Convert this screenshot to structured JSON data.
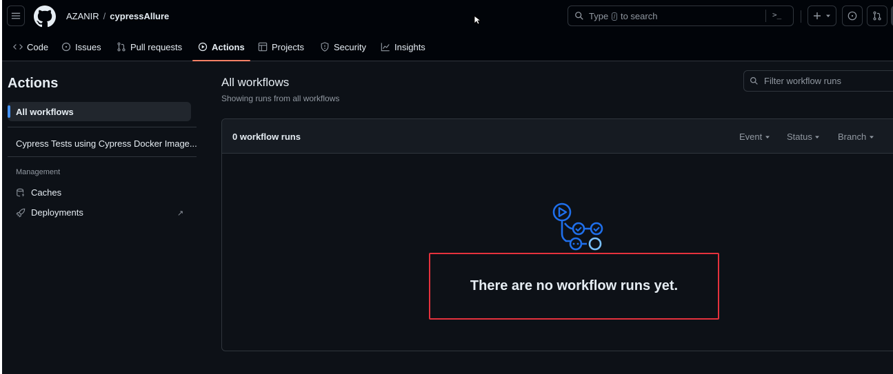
{
  "header": {
    "owner": "AZANIR",
    "separator": "/",
    "repo": "cypressAllure",
    "search_prefix": "Type",
    "search_key": "/",
    "search_suffix": "to search",
    "command_glyph": ">_"
  },
  "nav": {
    "tabs": [
      {
        "label": "Code",
        "icon": "code-icon"
      },
      {
        "label": "Issues",
        "icon": "issue-opened-icon"
      },
      {
        "label": "Pull requests",
        "icon": "git-pull-request-icon"
      },
      {
        "label": "Actions",
        "icon": "play-icon",
        "active": true
      },
      {
        "label": "Projects",
        "icon": "table-icon"
      },
      {
        "label": "Security",
        "icon": "shield-icon"
      },
      {
        "label": "Insights",
        "icon": "graph-icon"
      }
    ]
  },
  "sidebar": {
    "title": "Actions",
    "all_workflows": "All workflows",
    "workflow": "Cypress Tests using Cypress Docker Image...",
    "management_heading": "Management",
    "caches": "Caches",
    "deployments": "Deployments",
    "external_glyph": "↗"
  },
  "main": {
    "title": "All workflows",
    "subtitle": "Showing runs from all workflows",
    "filter_placeholder": "Filter workflow runs",
    "runs_count": "0 workflow runs",
    "filters": {
      "event": "Event",
      "status": "Status",
      "branch": "Branch"
    },
    "empty_message": "There are no workflow runs yet."
  },
  "colors": {
    "background": "#0d1117",
    "header": "#010409",
    "accent_underline": "#f78166",
    "active_marker": "#4493f8",
    "highlight_box": "#e5323d",
    "graph_blue": "#1f6feb"
  }
}
